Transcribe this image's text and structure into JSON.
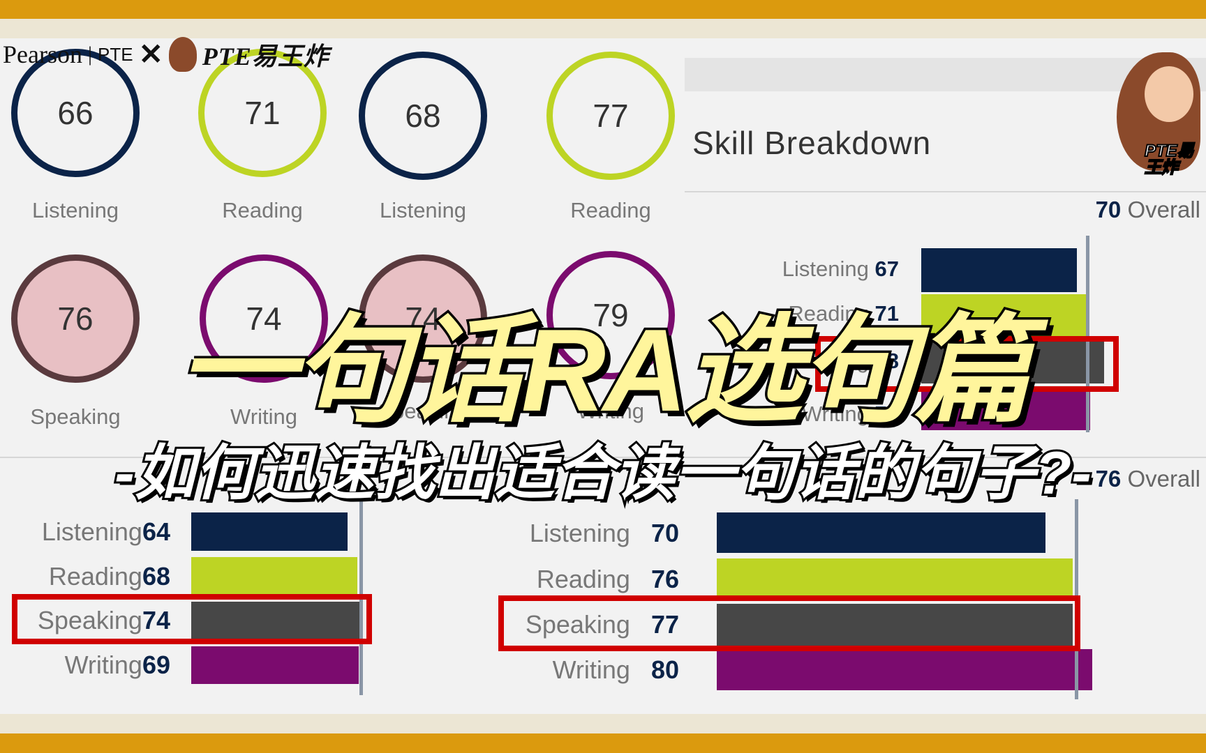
{
  "header": {
    "brand_left": "Pearson",
    "brand_sep": "PTE",
    "cross": "✕",
    "brand_right": "PTE易王炸"
  },
  "circles": [
    {
      "score": "66",
      "label": "Listening",
      "ring": "#0B2348",
      "fill": "none"
    },
    {
      "score": "71",
      "label": "Reading",
      "ring": "#BDD424",
      "fill": "none"
    },
    {
      "score": "68",
      "label": "Listening",
      "ring": "#0B2348",
      "fill": "none"
    },
    {
      "score": "77",
      "label": "Reading",
      "ring": "#BDD424",
      "fill": "none"
    },
    {
      "score": "76",
      "label": "Speaking",
      "ring": "#5A3A3E",
      "fill": "#E8C0C4"
    },
    {
      "score": "74",
      "label": "Writing",
      "ring": "#7B0B6E",
      "fill": "none"
    },
    {
      "score": "74",
      "label": "Speaking",
      "ring": "#5A3A3E",
      "fill": "#E8C0C4"
    },
    {
      "score": "79",
      "label": "Writing",
      "ring": "#7B0B6E",
      "fill": "none"
    }
  ],
  "skill_breakdown": {
    "title": "Skill Breakdown",
    "overall_score": "70",
    "overall_label": "Overall",
    "items": [
      {
        "label": "Listening",
        "score": "67"
      },
      {
        "label": "Reading",
        "score": "71"
      },
      {
        "label": "Speaking",
        "score": "78"
      },
      {
        "label": "Writing",
        "score": "72"
      }
    ]
  },
  "breakdown_left": {
    "items": [
      {
        "label": "Listening",
        "score": "64"
      },
      {
        "label": "Reading",
        "score": "68"
      },
      {
        "label": "Speaking",
        "score": "74"
      },
      {
        "label": "Writing",
        "score": "69"
      }
    ]
  },
  "breakdown_right": {
    "overall_score": "76",
    "overall_label": "Overall",
    "items": [
      {
        "label": "Listening",
        "score": "70"
      },
      {
        "label": "Reading",
        "score": "76"
      },
      {
        "label": "Speaking",
        "score": "77"
      },
      {
        "label": "Writing",
        "score": "80"
      }
    ]
  },
  "overlay": {
    "title": "一句话RA选句篇",
    "subtitle": "-如何迅速找出适合读一句话的句子?-"
  },
  "avatar": {
    "badge": "PTE易王炸"
  },
  "colors": {
    "listening": "#0B2348",
    "reading": "#BDD424",
    "speaking": "#474747",
    "writing": "#7B0B6E",
    "highlight": "#D00000",
    "band": "#DB9A0E"
  }
}
